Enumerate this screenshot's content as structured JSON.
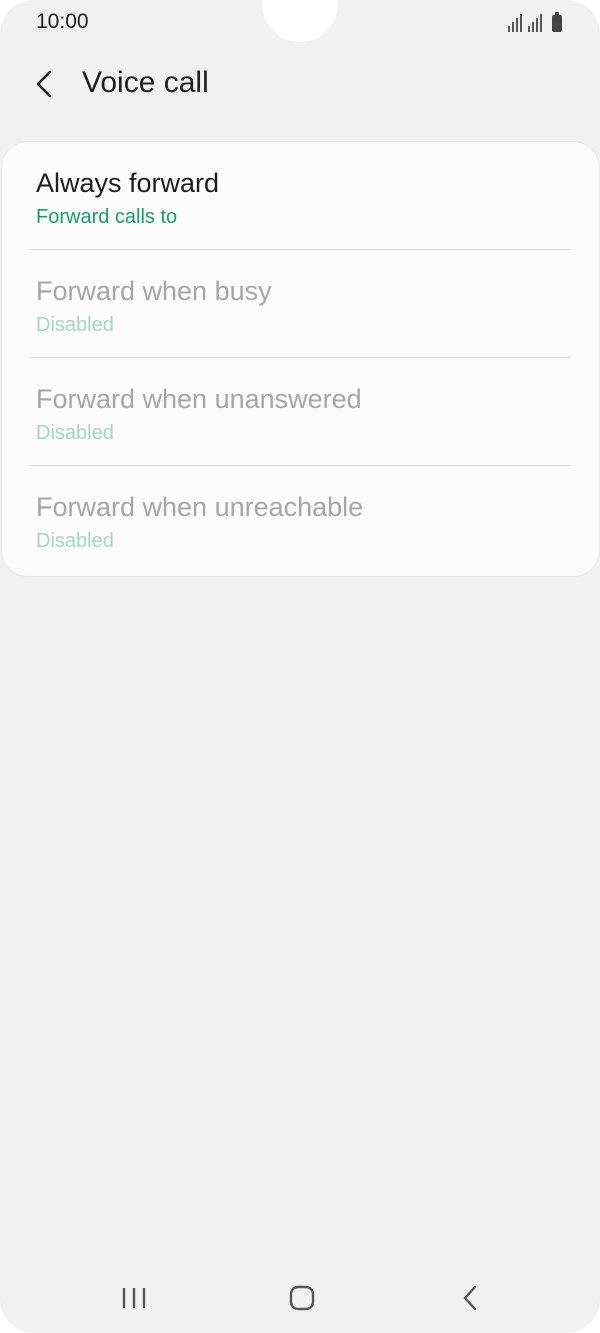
{
  "status_bar": {
    "time": "10:00",
    "icons": [
      "signal-icon",
      "signal-icon",
      "battery-icon"
    ]
  },
  "header": {
    "back_icon": "back-arrow-icon",
    "title": "Voice call"
  },
  "forward_options": [
    {
      "label": "Always forward",
      "value": "Forward calls to",
      "enabled": true
    },
    {
      "label": "Forward when busy",
      "value": "Disabled",
      "enabled": false
    },
    {
      "label": "Forward when unanswered",
      "value": "Disabled",
      "enabled": false
    },
    {
      "label": "Forward when unreachable",
      "value": "Disabled",
      "enabled": false
    }
  ],
  "nav_bar": {
    "icons": [
      "recent-apps-icon",
      "home-icon",
      "back-icon"
    ]
  },
  "colors": {
    "background": "#f1f1f1",
    "card": "#fcfcfc",
    "accent": "#15a06b",
    "accent_disabled": "#9fd8c0",
    "text_primary": "#1d1d1d",
    "text_disabled": "#a6a6a6"
  }
}
